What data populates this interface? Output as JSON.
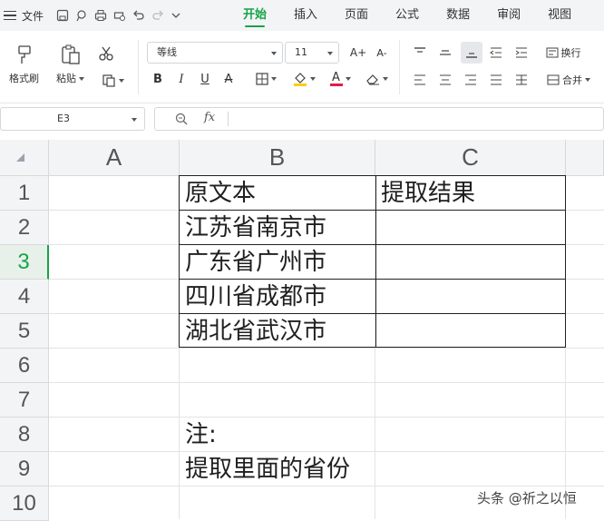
{
  "menubar": {
    "file_label": "文件",
    "tabs": [
      "开始",
      "插入",
      "页面",
      "公式",
      "数据",
      "审阅",
      "视图"
    ],
    "active_tab": "开始"
  },
  "ribbon": {
    "format_painter": "格式刷",
    "paste": "粘贴",
    "font_name": "等线",
    "font_size": "11",
    "wrap_text": "换行",
    "merge": "合并",
    "bold": "B",
    "italic": "I",
    "underline": "U",
    "strike": "A",
    "font_color_glyph": "A",
    "grow_font": "A+",
    "shrink_font": "A-",
    "font_color": "#e11d48",
    "fill_color": "#facc15"
  },
  "formula_bar": {
    "cell_ref": "E3",
    "fx_label": "fx",
    "content": ""
  },
  "sheet": {
    "columns": [
      "A",
      "B",
      "C"
    ],
    "rows": [
      "1",
      "2",
      "3",
      "4",
      "5",
      "6",
      "7",
      "8",
      "9",
      "10"
    ],
    "active_row": "3",
    "cells": {
      "B1": "原文本",
      "C1": "提取结果",
      "B2": "江苏省南京市",
      "B3": "广东省广州市",
      "B4": "四川省成都市",
      "B5": "湖北省武汉市",
      "B8": "注:",
      "B9": "提取里面的省份"
    }
  },
  "watermark": "头条 @祈之以恒",
  "accent_color": "#16a34a"
}
